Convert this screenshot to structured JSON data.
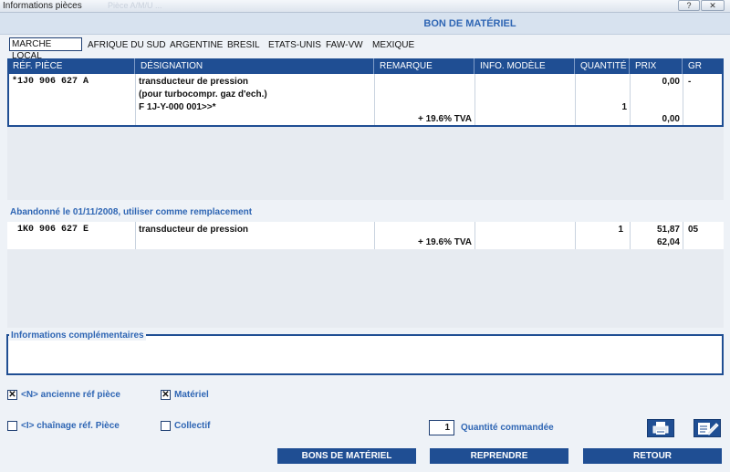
{
  "window": {
    "title": "Informations pièces",
    "ghost_title": "Pièce A/M/U  ... ",
    "help": "?",
    "close": "✕"
  },
  "header": {
    "title": "BON DE MATÉRIEL"
  },
  "tabs": [
    "MARCHE LOCAL",
    "AFRIQUE DU SUD",
    "ARGENTINE",
    "BRESIL",
    "ETATS-UNIS",
    "FAW-VW",
    "MEXIQUE"
  ],
  "table": {
    "columns": [
      "RÉF. PIÈCE",
      "DÉSIGNATION",
      "REMARQUE",
      "INFO. MODÈLE",
      "QUANTITÉ",
      "PRIX",
      "GR"
    ],
    "row1": {
      "ref": "*1J0 906 627 A",
      "designation": [
        "transducteur de pression",
        "(pour turbocompr. gaz d'ech.)",
        "F 1J-Y-000 001>>*"
      ],
      "remarque": "+ 19.6% TVA",
      "quantite": "1",
      "prix": "0,00",
      "prix_tva": "0,00",
      "gr": "-"
    },
    "replacement_note": "Abandonné le 01/11/2008, utiliser comme remplacement",
    "row2": {
      "ref": "1K0 906 627 E",
      "designation": "transducteur de pression",
      "remarque": "+ 19.6% TVA",
      "quantite": "1",
      "prix": "51,87",
      "prix_tva": "62,04",
      "gr": "05"
    }
  },
  "info": {
    "label": "Informations complémentaires"
  },
  "options": {
    "ancienne": {
      "label": "<N> ancienne réf pièce",
      "checked": true
    },
    "materiel": {
      "label": "Matériel",
      "checked": true
    },
    "chainage": {
      "label": "<I> chaînage réf. Pièce",
      "checked": false
    },
    "collectif": {
      "label": "Collectif",
      "checked": false
    }
  },
  "quantity": {
    "value": "1",
    "label": "Quantité commandée"
  },
  "icons": {
    "print": "printer-icon",
    "edit": "edit-icon"
  },
  "buttons": {
    "bons": "BONS DE MATÉRIEL",
    "reprendre": "REPRENDRE",
    "retour": "RETOUR"
  }
}
